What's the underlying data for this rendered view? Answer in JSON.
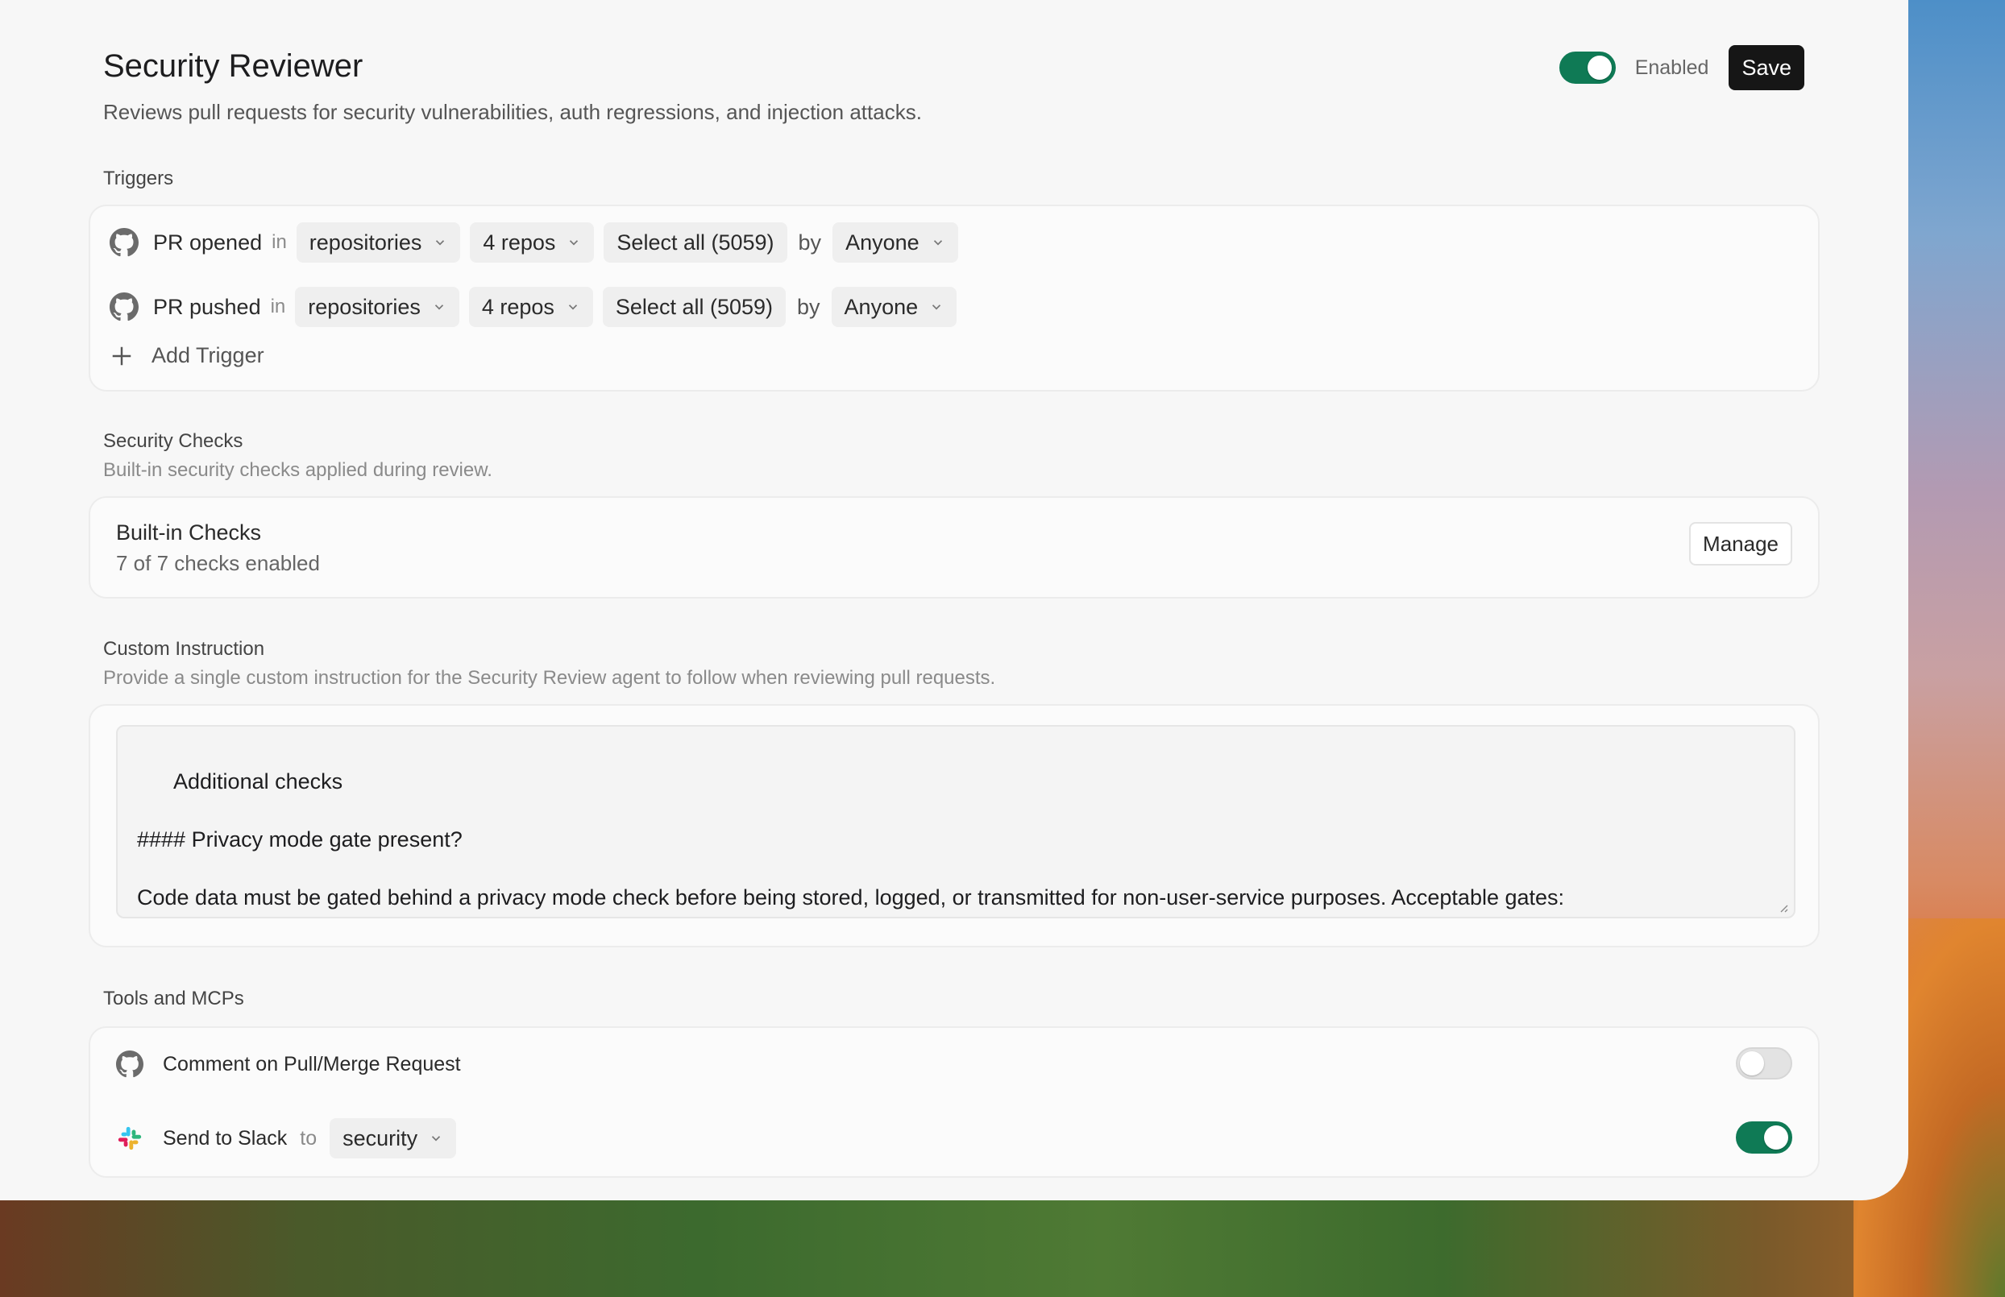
{
  "header": {
    "title": "Security Reviewer",
    "subtitle": "Reviews pull requests for security vulnerabilities, auth regressions, and injection attacks.",
    "enabled": true,
    "enabled_label": "Enabled",
    "save_label": "Save"
  },
  "triggers": {
    "section_title": "Triggers",
    "rows": [
      {
        "event": "PR opened",
        "in": "in",
        "scope": "repositories",
        "repos": "4 repos",
        "select_all": "Select all (5059)",
        "by": "by",
        "actor": "Anyone"
      },
      {
        "event": "PR pushed",
        "in": "in",
        "scope": "repositories",
        "repos": "4 repos",
        "select_all": "Select all (5059)",
        "by": "by",
        "actor": "Anyone"
      }
    ],
    "add_label": "Add Trigger"
  },
  "security_checks": {
    "section_title": "Security Checks",
    "section_desc": "Built-in security checks applied during review.",
    "card_title": "Built-in Checks",
    "card_sub": "7 of 7 checks enabled",
    "manage_label": "Manage"
  },
  "custom_instruction": {
    "section_title": "Custom Instruction",
    "section_desc": "Provide a single custom instruction for the Security Review agent to follow when reviewing pull requests.",
    "value": "Additional checks\n\n#### Privacy mode gate present?\n\nCode data must be gated behind a privacy mode check before being stored, logged, or transmitted for non-user-service purposes. Acceptable gates:\n- \\`ctx.ghostMode\\` / \\`ctx.privacyMode\\` check"
  },
  "tools": {
    "section_title": "Tools and MCPs",
    "items": [
      {
        "label": "Comment on Pull/Merge Request",
        "icon": "github-icon",
        "enabled": false
      },
      {
        "label": "Send to Slack",
        "icon": "slack-icon",
        "to": "to",
        "channel": "security",
        "enabled": true
      }
    ]
  },
  "colors": {
    "accent_green": "#0f7a55",
    "save_bg": "#161616",
    "window_bg": "#f7f7f7"
  }
}
